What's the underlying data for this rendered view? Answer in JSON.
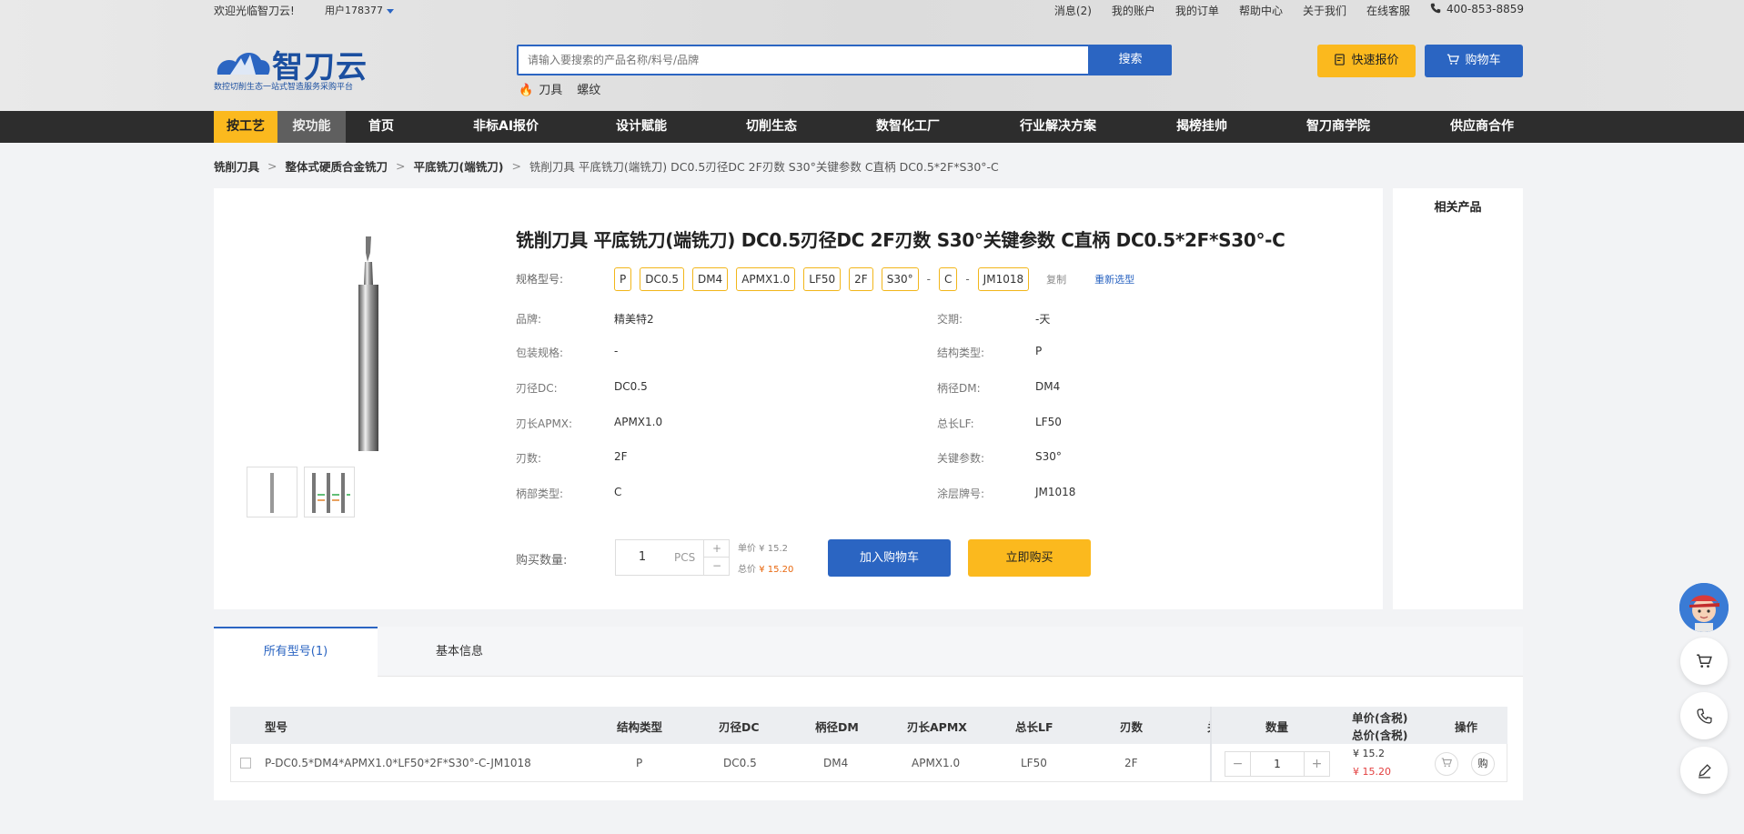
{
  "topbar": {
    "welcome": "欢迎光临智刀云!",
    "user": "用户178377",
    "links": [
      "消息(2)",
      "我的账户",
      "我的订单",
      "帮助中心",
      "关于我们",
      "在线客服"
    ],
    "phone": "400-853-8859"
  },
  "logo": {
    "name": "智刀云",
    "tagline": "数控切削生态一站式智造服务采购平台"
  },
  "search": {
    "placeholder": "请输入要搜索的产品名称/料号/品牌",
    "button": "搜索",
    "hotwords": [
      "刀具",
      "螺纹"
    ]
  },
  "actions": {
    "quick_quote": "快速报价",
    "cart": "购物车"
  },
  "nav": {
    "tab_process": "按工艺",
    "tab_function": "按功能",
    "items": [
      "首页",
      "非标AI报价",
      "设计赋能",
      "切削生态",
      "数智化工厂",
      "行业解决方案",
      "揭榜挂帅",
      "智刀商学院",
      "供应商合作"
    ]
  },
  "breadcrumb": [
    "铣削刀具",
    "整体式硬质合金铣刀",
    "平底铣刀(端铣刀)",
    "铣削刀具 平底铣刀(端铣刀) DC0.5刃径DC 2F刃数 S30°关键参数 C直柄 DC0.5*2F*S30°-C"
  ],
  "product": {
    "title": "铣削刀具 平底铣刀(端铣刀) DC0.5刃径DC 2F刃数 S30°关键参数 C直柄 DC0.5*2F*S30°-C",
    "spec_label": "规格型号:",
    "spec_chips": [
      "P",
      "DC0.5",
      "DM4",
      "APMX1.0",
      "LF50",
      "2F",
      "S30°",
      "-",
      "C",
      "-",
      "JM1018"
    ],
    "copy": "复制",
    "reselect": "重新选型",
    "attrs_left": [
      {
        "label": "品牌:",
        "value": "精美特2"
      },
      {
        "label": "包装规格:",
        "value": "-"
      },
      {
        "label": "刃径DC:",
        "value": "DC0.5"
      },
      {
        "label": "刃长APMX:",
        "value": "APMX1.0"
      },
      {
        "label": "刃数:",
        "value": "2F"
      },
      {
        "label": "柄部类型:",
        "value": "C"
      }
    ],
    "attrs_right": [
      {
        "label": "交期:",
        "value": "-天"
      },
      {
        "label": "结构类型:",
        "value": "P"
      },
      {
        "label": "柄径DM:",
        "value": "DM4"
      },
      {
        "label": "总长LF:",
        "value": "LF50"
      },
      {
        "label": "关键参数:",
        "value": "S30°"
      },
      {
        "label": "涂层牌号:",
        "value": "JM1018"
      }
    ],
    "qty_label": "购买数量:",
    "qty": "1",
    "unit": "PCS",
    "unit_price_label": "单价 ¥ 15.2",
    "total_label": "总价",
    "total_value": "¥ 15.20",
    "add_cart": "加入购物车",
    "buy_now": "立即购买"
  },
  "related": {
    "title": "相关产品"
  },
  "tabs": {
    "all_models": "所有型号(1)",
    "basic_info": "基本信息"
  },
  "table": {
    "headers": [
      "型号",
      "结构类型",
      "刃径DC",
      "柄径DM",
      "刃长APMX",
      "总长LF",
      "刃数",
      "关",
      "数量",
      "单价(含税)",
      "总价(含税)",
      "操作"
    ],
    "row": {
      "model": "P-DC0.5*DM4*APMX1.0*LF50*2F*S30°-C-JM1018",
      "structure": "P",
      "dc": "DC0.5",
      "dm": "DM4",
      "apmx": "APMX1.0",
      "lf": "LF50",
      "flutes": "2F",
      "qty": "1",
      "unit_price": "¥ 15.2",
      "total_price": "¥ 15.20",
      "buy": "购"
    }
  },
  "colors": {
    "primary": "#2b65c2",
    "accent": "#fbb91e",
    "nav_bg": "#2d2d2d",
    "price_red": "#e34040"
  }
}
